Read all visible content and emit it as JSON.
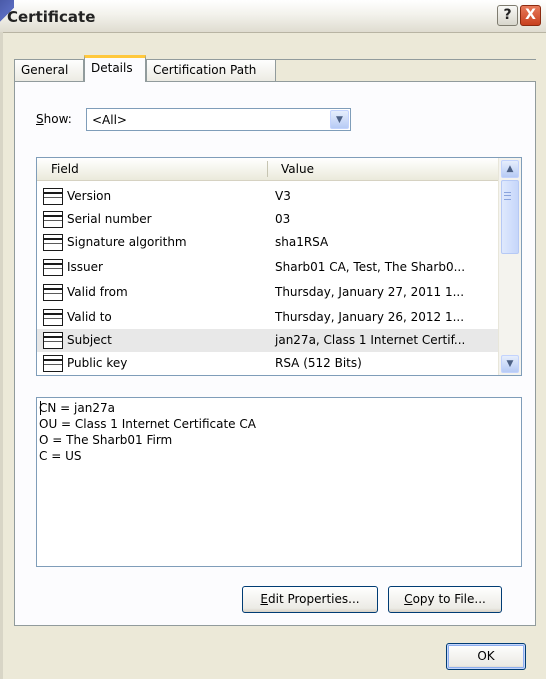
{
  "window": {
    "title": "Certificate"
  },
  "titlebar": {
    "help_label": "?",
    "close_label": "X"
  },
  "tabs": [
    {
      "label": "General",
      "active": false
    },
    {
      "label": "Details",
      "active": true
    },
    {
      "label": "Certification Path",
      "active": false
    }
  ],
  "show": {
    "label_mnemonic": "S",
    "label_rest": "how:",
    "value": "<All>"
  },
  "fields": {
    "columns": [
      "Field",
      "Value"
    ],
    "rows": [
      {
        "field": "Version",
        "value": "V3"
      },
      {
        "field": "Serial number",
        "value": "03"
      },
      {
        "field": "Signature algorithm",
        "value": "sha1RSA"
      },
      {
        "field": "Issuer",
        "value": "Sharb01 CA, Test, The Sharb0..."
      },
      {
        "field": "Valid from",
        "value": "Thursday, January 27, 2011 1..."
      },
      {
        "field": "Valid to",
        "value": "Thursday, January 26, 2012 1..."
      },
      {
        "field": "Subject",
        "value": "jan27a, Class 1 Internet Certif...",
        "selected": true
      },
      {
        "field": "Public key",
        "value": "RSA (512 Bits)"
      }
    ]
  },
  "details": {
    "lines": [
      "CN = jan27a",
      "OU = Class 1 Internet Certificate CA",
      "O = The Sharb01 Firm",
      "C = US"
    ]
  },
  "buttons": {
    "edit_properties": {
      "mnemonic": "E",
      "rest": "dit Properties..."
    },
    "copy_to_file": {
      "mnemonic": "C",
      "rest": "opy to File..."
    },
    "ok": "OK"
  },
  "icons": {
    "field_row": "certificate-field-icon",
    "combo_arrow": "chevron-down-icon",
    "scroll_up": "chevron-up-icon",
    "scroll_down": "chevron-down-icon"
  },
  "colors": {
    "active_tab_accent": "#ffc83c",
    "close_button": "#c8401f",
    "border_blue": "#7f9db9",
    "window_bg": "#ece9d8"
  }
}
